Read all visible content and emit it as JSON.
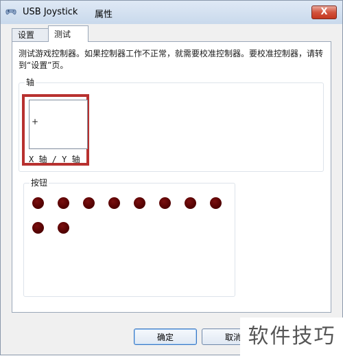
{
  "window": {
    "title": "USB Joystick",
    "title_suffix": "属性",
    "close_symbol": "X"
  },
  "tabs": [
    {
      "label": "设置",
      "active": false
    },
    {
      "label": "测试",
      "active": true
    }
  ],
  "panel": {
    "description": "测试游戏控制器。如果控制器工作不正常，就需要校准控制器。要校准控制器，请转到“设置”页。"
  },
  "axis_group": {
    "title": "轴",
    "crosshair": "+",
    "label": "X 轴 / Y 轴",
    "highlight_color": "#b8312f"
  },
  "buttons_group": {
    "title": "按钮",
    "count": 10,
    "dot_color": "#5a0505"
  },
  "footer": {
    "ok_label": "确定",
    "cancel_label": "取消"
  },
  "watermark": {
    "text": "软件技巧"
  }
}
